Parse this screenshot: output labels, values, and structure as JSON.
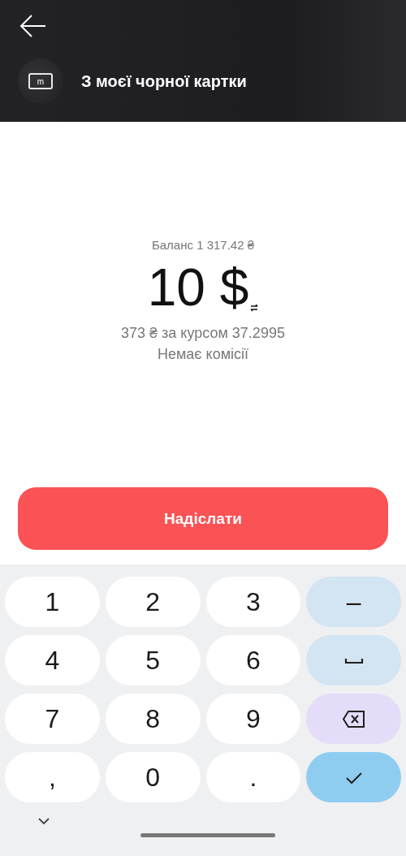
{
  "header": {
    "title": "З моєї чорної картки",
    "card_letter": "m"
  },
  "amount": {
    "balance": "Баланс 1 317.42 ₴",
    "value": "10 $",
    "rate": "373 ₴ за курсом 37.2995",
    "commission": "Немає комісії"
  },
  "send_button": {
    "label": "Надіслати"
  },
  "keyboard": {
    "keys": [
      {
        "kind": "char",
        "label": "1"
      },
      {
        "kind": "char",
        "label": "2"
      },
      {
        "kind": "char",
        "label": "3"
      },
      {
        "kind": "symbol",
        "label": "–"
      },
      {
        "kind": "char",
        "label": "4"
      },
      {
        "kind": "char",
        "label": "5"
      },
      {
        "kind": "char",
        "label": "6"
      },
      {
        "kind": "space"
      },
      {
        "kind": "char",
        "label": "7"
      },
      {
        "kind": "char",
        "label": "8"
      },
      {
        "kind": "char",
        "label": "9"
      },
      {
        "kind": "backspace"
      },
      {
        "kind": "char",
        "label": ","
      },
      {
        "kind": "char",
        "label": "0"
      },
      {
        "kind": "char",
        "label": "."
      },
      {
        "kind": "enter"
      }
    ]
  }
}
